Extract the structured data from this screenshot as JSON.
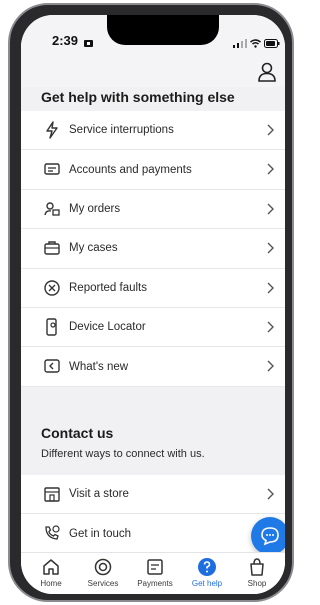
{
  "status_bar": {
    "time": "2:39"
  },
  "help": {
    "title": "Get help with something else",
    "items": [
      {
        "label": "Service interruptions",
        "icon": "lightning-icon"
      },
      {
        "label": "Accounts and payments",
        "icon": "bill-icon"
      },
      {
        "label": "My orders",
        "icon": "orders-icon"
      },
      {
        "label": "My cases",
        "icon": "briefcase-icon"
      },
      {
        "label": "Reported faults",
        "icon": "fault-icon"
      },
      {
        "label": "Device Locator",
        "icon": "device-locator-icon"
      },
      {
        "label": "What's new",
        "icon": "whats-new-icon"
      }
    ]
  },
  "contact": {
    "title": "Contact us",
    "subtitle": "Different ways to connect with us.",
    "items": [
      {
        "label": "Visit a store",
        "icon": "store-icon"
      },
      {
        "label": "Get in touch",
        "icon": "contact-icon"
      }
    ]
  },
  "tabs": [
    {
      "label": "Home",
      "icon": "home-icon",
      "active": false
    },
    {
      "label": "Services",
      "icon": "services-icon",
      "active": false
    },
    {
      "label": "Payments",
      "icon": "payments-icon",
      "active": false
    },
    {
      "label": "Get help",
      "icon": "help-icon",
      "active": true
    },
    {
      "label": "Shop",
      "icon": "shop-icon",
      "active": false
    }
  ],
  "colors": {
    "accent": "#1f7ae8",
    "background": "#f1f1f3"
  }
}
